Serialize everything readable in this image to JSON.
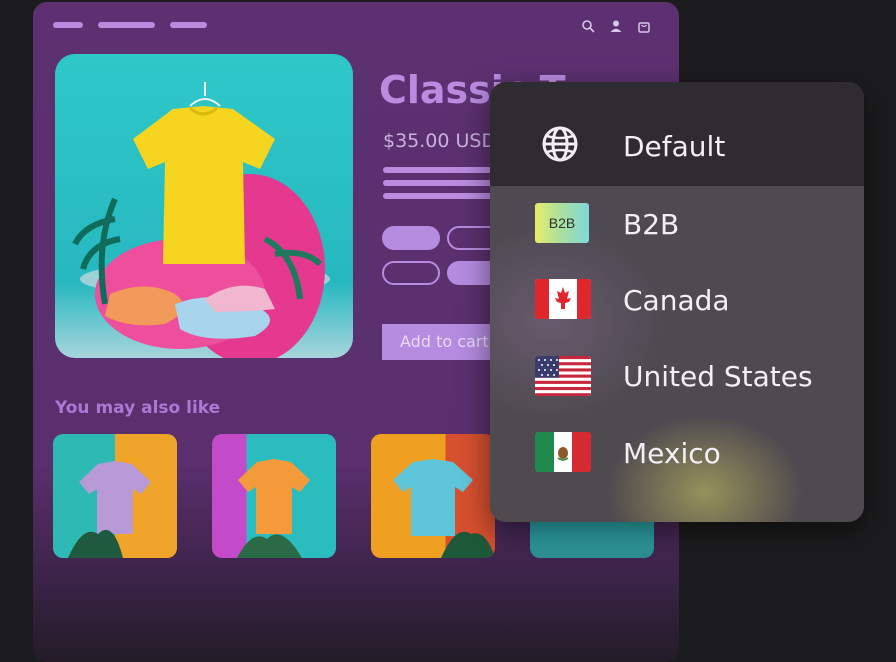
{
  "header": {
    "icons": [
      "search-icon",
      "account-icon",
      "cart-icon"
    ]
  },
  "product": {
    "title": "Classic T",
    "price": "$35.00 USD",
    "add_to_cart": "Add to cart"
  },
  "recommendations": {
    "heading": "You may also like"
  },
  "market_selector": {
    "options": [
      {
        "label": "Default",
        "icon": "globe-icon",
        "selected": true
      },
      {
        "label": "B2B",
        "icon": "b2b-badge",
        "badge_text": "B2B"
      },
      {
        "label": "Canada",
        "icon": "canada-flag-icon"
      },
      {
        "label": "United States",
        "icon": "us-flag-icon"
      },
      {
        "label": "Mexico",
        "icon": "mexico-flag-icon"
      }
    ]
  },
  "colors": {
    "store_bg": "#5d3171",
    "accent": "#b98ce0",
    "dropdown_bg": "#4d4a50",
    "dropdown_selected": "#2e2c30"
  }
}
